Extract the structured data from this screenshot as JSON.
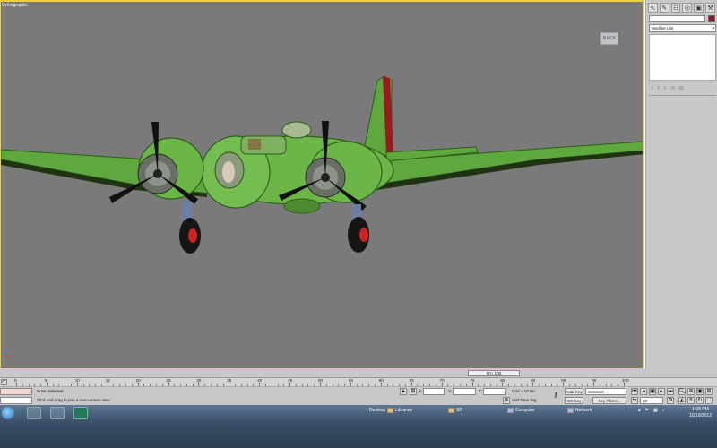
{
  "viewport": {
    "label": "Orthographic",
    "viewcube_label": "BACK"
  },
  "command_panel": {
    "modifier_list": "Modifier List"
  },
  "time_slider": {
    "frame_display": "80 / 100"
  },
  "track_bar": {
    "ticks": [
      "0",
      "5",
      "10",
      "15",
      "20",
      "25",
      "30",
      "35",
      "40",
      "45",
      "50",
      "55",
      "60",
      "65",
      "70",
      "75",
      "80",
      "85",
      "90",
      "95",
      "100"
    ]
  },
  "status_bar": {
    "selection": "None Selected",
    "prompt": "Click and drag to pan a non-camera view",
    "x_label": "X:",
    "y_label": "Y:",
    "z_label": "Z:",
    "grid": "Grid = 10.0in",
    "add_time_tag": "Add Time Tag",
    "auto_key": "Auto Key",
    "set_key": "Set Key",
    "selected_dropdown": "Selected",
    "key_filters": "Key Filters...",
    "frame_field": "80"
  },
  "taskbar": {
    "desktop": "Desktop",
    "libraries": "Libraries",
    "sd": "SD",
    "computer": "Computer",
    "network": "Network",
    "time": "1:08 PM",
    "date": "10/19/2012"
  }
}
